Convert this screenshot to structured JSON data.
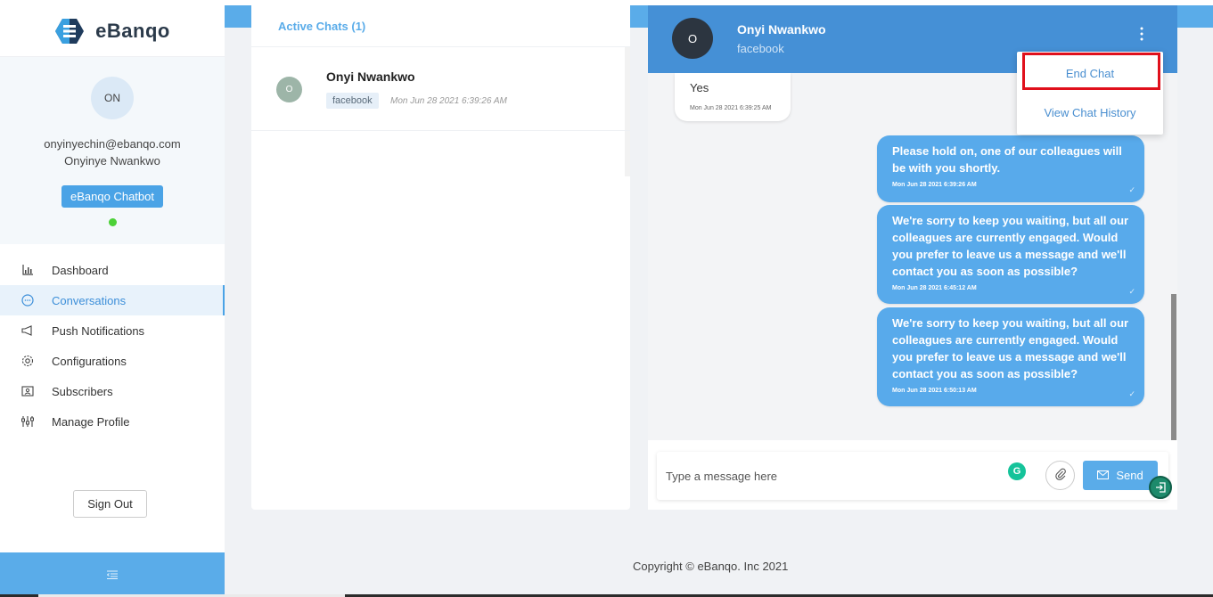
{
  "brand": {
    "name": "eBanqo"
  },
  "profile": {
    "initials": "ON",
    "email": "onyinyechin@ebanqo.com",
    "name": "Onyinye Nwankwo",
    "badge": "eBanqo Chatbot"
  },
  "nav": {
    "items": [
      {
        "label": "Dashboard",
        "icon": "bar-chart-icon"
      },
      {
        "label": "Conversations",
        "icon": "chat-bubble-icon",
        "active": true
      },
      {
        "label": "Push Notifications",
        "icon": "megaphone-icon"
      },
      {
        "label": "Configurations",
        "icon": "gear-icon"
      },
      {
        "label": "Subscribers",
        "icon": "contact-card-icon"
      },
      {
        "label": "Manage Profile",
        "icon": "sliders-icon"
      }
    ]
  },
  "signout_label": "Sign Out",
  "chat_list": {
    "title": "Active Chats (1)",
    "items": [
      {
        "initial": "O",
        "name": "Onyi Nwankwo",
        "channel": "facebook",
        "time": "Mon Jun 28 2021 6:39:26 AM"
      }
    ]
  },
  "chat": {
    "contact_initial": "O",
    "contact_name": "Onyi Nwankwo",
    "contact_channel": "facebook",
    "menu": {
      "end_chat": "End Chat",
      "view_history": "View Chat History"
    },
    "messages": [
      {
        "direction": "in",
        "text": "Yes",
        "time": "Mon Jun 28 2021 6:39:25 AM"
      },
      {
        "direction": "out",
        "text": "Please hold on, one of our colleagues will be with you shortly.",
        "time": "Mon Jun 28 2021 6:39:26 AM"
      },
      {
        "direction": "out",
        "text": "We're sorry to keep you waiting, but all our colleagues are currently engaged. Would you prefer to leave us a message and we'll contact you as soon as possible?",
        "time": "Mon Jun 28 2021 6:45:12 AM"
      },
      {
        "direction": "out",
        "text": "We're sorry to keep you waiting, but all our colleagues are currently engaged. Would you prefer to leave us a message and we'll contact you as soon as possible?",
        "time": "Mon Jun 28 2021 6:50:13 AM"
      }
    ],
    "input_placeholder": "Type a message here",
    "send_label": "Send"
  },
  "footer": {
    "copyright": "Copyright © eBanqo. Inc 2021"
  },
  "colors": {
    "accent": "#5aace9",
    "header": "#4590d6",
    "highlight": "#e0101c",
    "online": "#4cd137"
  }
}
